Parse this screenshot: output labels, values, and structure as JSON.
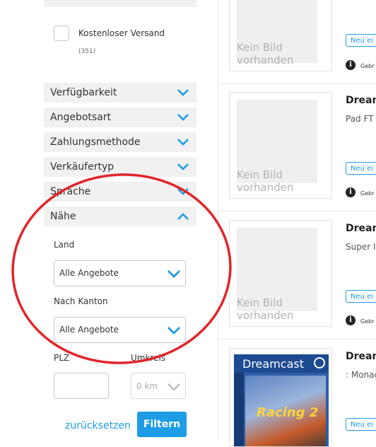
{
  "sidebar": {
    "free_shipping_label": "Kostenloser Versand",
    "free_shipping_count": "(351)",
    "accordions": [
      {
        "label": "Verfügbarkeit"
      },
      {
        "label": "Angebotsart"
      },
      {
        "label": "Zahlungsmethode"
      },
      {
        "label": "Verkäufertyp"
      },
      {
        "label": "Sprache"
      },
      {
        "label": "Nähe"
      }
    ],
    "naehe": {
      "land_label": "Land",
      "land_value": "Alle Angebote",
      "kanton_label": "Nach Kanton",
      "kanton_value": "Alle Angebote",
      "plz_label": "PLZ",
      "umkreis_label": "Umkreis",
      "umkreis_value": "0 km"
    },
    "reset_label": "zurücksetzen",
    "filter_label": "Filtern"
  },
  "listings": [
    {
      "title": "",
      "subtitle": "",
      "image_text": "Kein Bild\nvorhanden",
      "badge": "Neu ei",
      "info_text": "Gebr"
    },
    {
      "title": "Dream",
      "subtitle": "Pad FT",
      "image_text": "Kein Bild\nvorhanden",
      "badge": "Neu ei",
      "info_text": "Gebr"
    },
    {
      "title": "Dream",
      "subtitle": "Super I",
      "image_text": "Kein Bild\nvorhanden",
      "badge": "Neu ei",
      "info_text": "Gebr"
    },
    {
      "title": "Dream",
      "subtitle": ": Monac",
      "cover_logo": "Dreamcast",
      "cover_title": "Racing 2",
      "badge": "Neu ei"
    }
  ],
  "colors": {
    "accent": "#1e9ce5",
    "annotation_circle": "#e0262b",
    "accordion_bg": "#f1f1f1"
  }
}
